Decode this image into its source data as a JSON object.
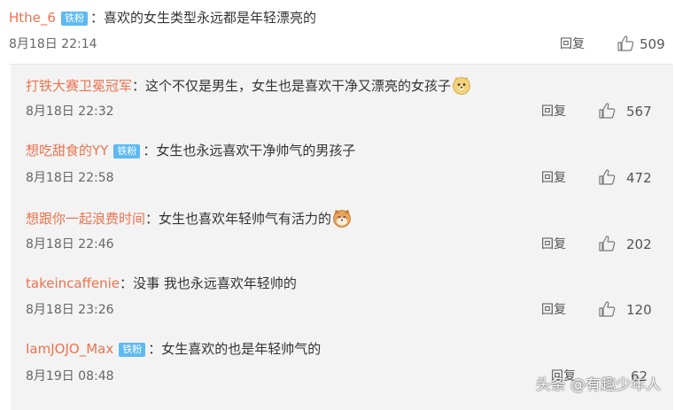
{
  "top_comment": {
    "username": "Hthe_6",
    "badge": "铁粉",
    "colon": "：",
    "text": "喜欢的女生类型永远都是年轻漂亮的",
    "date": "8月18日 22:14",
    "reply_label": "回复",
    "likes": "509"
  },
  "replies": [
    {
      "username": "打铁大赛卫冕冠军",
      "badge": "",
      "colon": "：",
      "text": "这个不仅是男生，女生也是喜欢干净又漂亮的女孩子",
      "emoji": "doge-emoji",
      "date": "8月18日 22:32",
      "reply_label": "回复",
      "likes": "567"
    },
    {
      "username": "想吃甜食的YY",
      "badge": "铁粉",
      "colon": "：",
      "text": "女生也永远喜欢干净帅气的男孩子",
      "emoji": "",
      "date": "8月18日 22:58",
      "reply_label": "回复",
      "likes": "472"
    },
    {
      "username": "想跟你一起浪费时间",
      "badge": "",
      "colon": "：",
      "text": "女生也喜欢年轻帅气有活力的",
      "emoji": "shiba-emoji",
      "date": "8月18日 22:46",
      "reply_label": "回复",
      "likes": "202"
    },
    {
      "username": "takeincaffenie",
      "badge": "",
      "colon": "：",
      "text": "没事 我也永远喜欢年轻帅的",
      "emoji": "",
      "date": "8月18日 23:26",
      "reply_label": "回复",
      "likes": "120"
    },
    {
      "username": "IamJOJO_Max",
      "badge": "铁粉",
      "colon": "：",
      "text": "女生喜欢的也是年轻帅气的",
      "emoji": "",
      "date": "8月19日 08:48",
      "reply_label": "回复",
      "likes": "62"
    }
  ],
  "watermark": "头条 @有趣少年人",
  "colors": {
    "username": "#eb7350",
    "badge": "#5eb9f0",
    "reply_bg": "#f3f3f3"
  },
  "icons": {
    "like": "thumbs-up-icon"
  }
}
